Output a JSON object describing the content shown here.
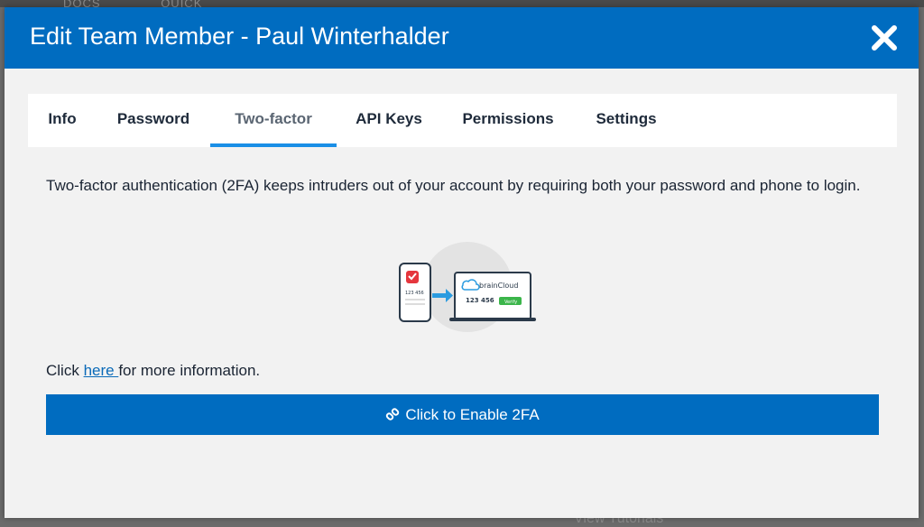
{
  "background": {
    "top_labels": [
      "DOCS",
      "QUICK"
    ],
    "bottom_label": "View Tutorials"
  },
  "modal": {
    "title": "Edit Team Member - Paul Winterhalder",
    "close_icon": "close-icon",
    "header_color": "#006cc0"
  },
  "tabs": [
    {
      "label": "Info",
      "active": false
    },
    {
      "label": "Password",
      "active": false
    },
    {
      "label": "Two-factor",
      "active": true
    },
    {
      "label": "API Keys",
      "active": false
    },
    {
      "label": "Permissions",
      "active": false
    },
    {
      "label": "Settings",
      "active": false
    }
  ],
  "content": {
    "intro": "Two-factor authentication (2FA) keeps intruders out of your account by requiring both your password and phone to login.",
    "illustration": {
      "phone_code": "123 456",
      "laptop_brand": "brainCloud",
      "laptop_code": "123 456",
      "verify_label": "Verify"
    },
    "info_prefix": "Click ",
    "info_link": "here ",
    "info_suffix": "for more information.",
    "enable_button_label": "Click to Enable 2FA",
    "enable_button_icon": "link-icon"
  },
  "colors": {
    "accent": "#006cc0",
    "tab_underline": "#1a8fe6",
    "link": "#0a6ab8"
  }
}
